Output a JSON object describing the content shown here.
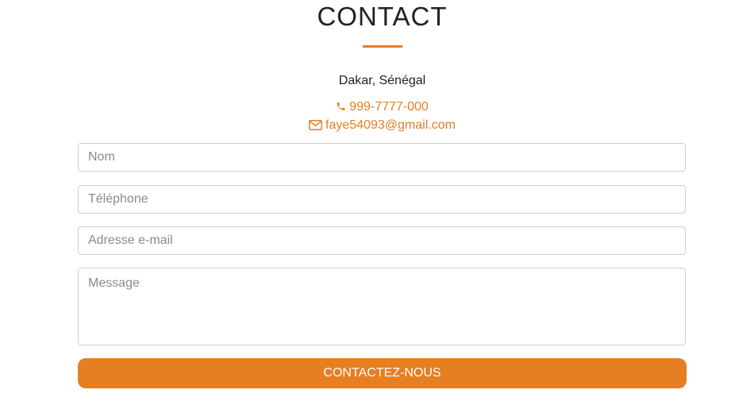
{
  "section": {
    "title": "CONTACT",
    "accent_color": "#e67e22"
  },
  "info": {
    "address": "Dakar, Sénégal",
    "phone": "999-7777-000",
    "email": "faye54093@gmail.com",
    "phone_icon": "phone-icon",
    "email_icon": "envelope-icon"
  },
  "form": {
    "name_placeholder": "Nom",
    "phone_placeholder": "Téléphone",
    "email_placeholder": "Adresse e-mail",
    "message_placeholder": "Message",
    "submit_label": "CONTACTEZ-NOUS"
  }
}
